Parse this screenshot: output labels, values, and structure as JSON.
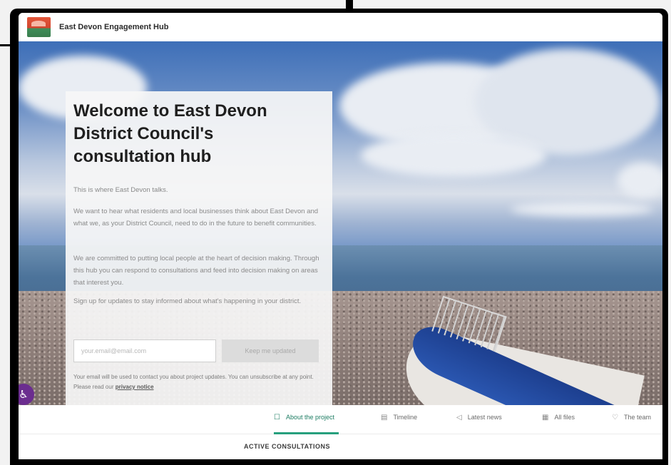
{
  "site": {
    "title": "East Devon Engagement Hub"
  },
  "welcome": {
    "heading": "Welcome to East Devon District Council's consultation hub",
    "intro": "This is where East Devon talks.",
    "para1": "We want to hear what residents and local businesses think about East Devon and what we, as your District Council, need to do in the future to benefit communities.",
    "para2": "We are committed to putting local people at the heart of decision making. Through this hub you can respond to consultations and feed into decision making on areas that interest you.",
    "para3": "Sign up for updates to stay informed about what's happening in your district.",
    "email_placeholder": "your.email@email.com",
    "subscribe_label": "Keep me updated",
    "note_text": "Your email will be used to contact you about project updates. You can unsubscribe at any point. Please read our",
    "privacy_label": "privacy notice"
  },
  "tabs": [
    {
      "label": "About the project",
      "icon": "document-icon"
    },
    {
      "label": "Timeline",
      "icon": "calendar-icon"
    },
    {
      "label": "Latest news",
      "icon": "megaphone-icon"
    },
    {
      "label": "All files",
      "icon": "files-icon"
    },
    {
      "label": "The team",
      "icon": "person-icon"
    }
  ],
  "sections": {
    "active": "ACTIVE CONSULTATIONS"
  },
  "colors": {
    "accent": "#27a07d",
    "accessibility": "#6b2d8f"
  }
}
